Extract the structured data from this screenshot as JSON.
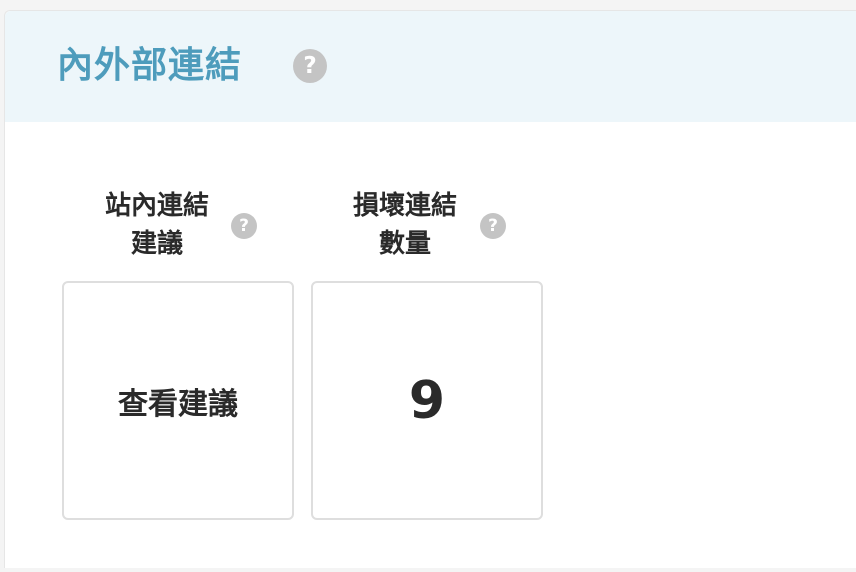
{
  "section": {
    "title": "內外部連結",
    "help_icon": "question-circle-icon"
  },
  "metrics": [
    {
      "label_line1": "站內連結",
      "label_line2": "建議",
      "value": "查看建議",
      "help_icon": "question-circle-icon"
    },
    {
      "label_line1": "損壞連結",
      "label_line2": "數量",
      "value": "9",
      "help_icon": "question-circle-icon"
    }
  ],
  "help_glyph": "?",
  "colors": {
    "header_bg": "#edf6fa",
    "title": "#4e9cbc",
    "help_icon": "#c4c4c4",
    "box_border": "#dedede"
  }
}
